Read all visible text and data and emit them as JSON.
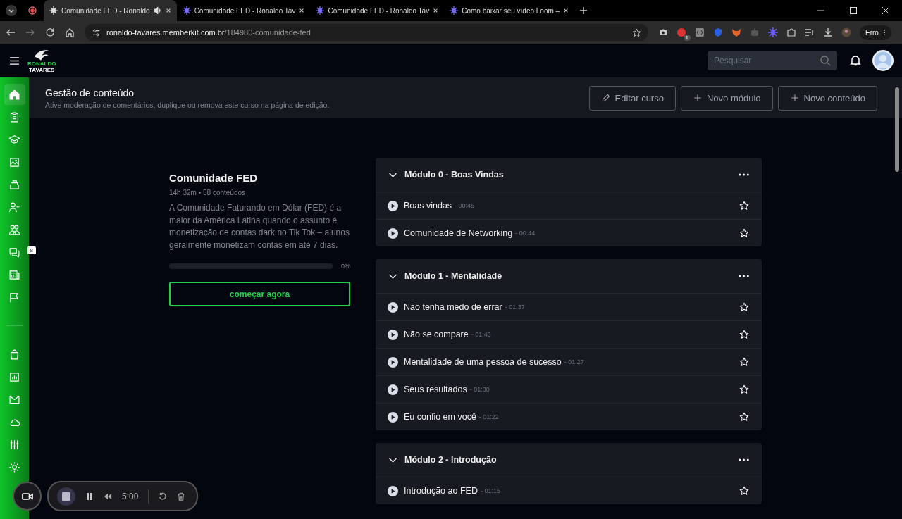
{
  "browser": {
    "tabs": [
      {
        "title": "Comunidade FED - Ronaldo",
        "selected": true,
        "audio": true
      },
      {
        "title": "Comunidade FED - Ronaldo Tav",
        "selected": false,
        "audio": false
      },
      {
        "title": "Comunidade FED - Ronaldo Tav",
        "selected": false,
        "audio": false
      },
      {
        "title": "Como baixar seu vídeo Loom –",
        "selected": false,
        "audio": false
      }
    ],
    "address": {
      "host": "ronaldo-tavares.memberkit.com.br",
      "path": "/184980-comunidade-fed"
    },
    "extension_badge": "1",
    "profile_button": "Erro"
  },
  "app": {
    "logo": {
      "line_1": "RONALDO",
      "line_2": "TAVARES"
    },
    "search": {
      "placeholder": "Pesquisar"
    }
  },
  "sidebar": {
    "top_items": [
      {
        "selected": true
      },
      {
        "selected": false
      },
      {
        "selected": false
      },
      {
        "selected": false
      },
      {
        "selected": false
      },
      {
        "selected": false
      },
      {
        "selected": false
      },
      {
        "selected": false,
        "badge": "8"
      },
      {
        "selected": false
      },
      {
        "selected": false
      }
    ],
    "bottom_items": [
      {
        "selected": false
      },
      {
        "selected": false
      },
      {
        "selected": false
      },
      {
        "selected": false
      },
      {
        "selected": false
      },
      {
        "selected": false
      }
    ]
  },
  "content_header": {
    "title": "Gestão de conteúdo",
    "subtitle": "Ative moderação de comentários, duplique ou remova este curso na página de edição.",
    "buttons": [
      {
        "label": "Editar curso",
        "kind": "edit"
      },
      {
        "label": "Novo módulo",
        "kind": "add"
      },
      {
        "label": "Novo conteúdo",
        "kind": "add"
      }
    ]
  },
  "course": {
    "title": "Comunidade FED",
    "meta": "14h 32m • 58 conteúdos",
    "description": "A Comunidade Faturando em Dólar (FED) é a maior da América Latina quando o assunto é monetização de contas dark no Tik Tok – alunos geralmente monetizam contas em até 7 dias.",
    "progress": {
      "level": 0,
      "reading": "0%"
    },
    "start_button": "começar agora"
  },
  "modules": [
    {
      "title": "Módulo 0 - Boas Vindas",
      "expanded": true,
      "lessons": [
        {
          "title": "Boas vindas",
          "duration": "- 00:45",
          "starred": false
        },
        {
          "title": "Comunidade de Networking",
          "duration": "- 00:44",
          "starred": false
        }
      ]
    },
    {
      "title": "Módulo 1 - Mentalidade",
      "expanded": true,
      "lessons": [
        {
          "title": "Não tenha medo de errar",
          "duration": "- 01:37",
          "starred": false
        },
        {
          "title": "Não se compare",
          "duration": "- 01:43",
          "starred": false
        },
        {
          "title": "Mentalidade de uma pessoa de sucesso",
          "duration": "- 01:27",
          "starred": false
        },
        {
          "title": "Seus resultados",
          "duration": "- 01:30",
          "starred": false
        },
        {
          "title": "Eu confio em você",
          "duration": "- 01:22",
          "starred": false
        }
      ]
    },
    {
      "title": "Módulo 2 - Introdução",
      "expanded": true,
      "lessons": [
        {
          "title": "Introdução ao FED",
          "duration": "- 01:15",
          "starred": false
        }
      ]
    }
  ],
  "recorder": {
    "time": "5:00"
  }
}
